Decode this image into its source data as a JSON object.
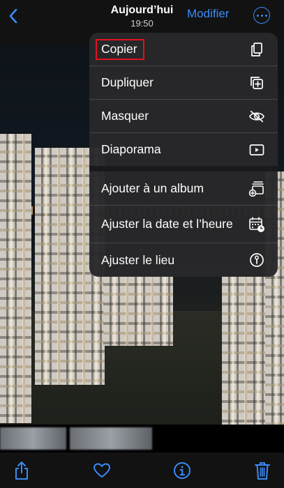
{
  "header": {
    "back_icon": "chevron-left-icon",
    "title": "Aujourd’hui",
    "subtitle": "19:50",
    "edit_label": "Modifier",
    "more_icon": "ellipsis-circle-icon",
    "accent_color": "#3b8bf6"
  },
  "menu": {
    "items": [
      {
        "label": "Copier",
        "icon": "copy-icon",
        "highlighted": true
      },
      {
        "label": "Dupliquer",
        "icon": "duplicate-icon"
      },
      {
        "label": "Masquer",
        "icon": "eye-slash-icon"
      },
      {
        "label": "Diaporama",
        "icon": "play-rectangle-icon"
      },
      {
        "label": "Ajouter à un album",
        "icon": "add-to-album-icon"
      },
      {
        "label": "Ajuster la date et l’heure",
        "icon": "calendar-adjust-icon"
      },
      {
        "label": "Ajuster le lieu",
        "icon": "location-info-icon"
      }
    ],
    "highlight_color": "#e0141e"
  },
  "toolbar": {
    "share_icon": "share-icon",
    "favorite_icon": "heart-icon",
    "info_icon": "info-icon",
    "delete_icon": "trash-icon"
  }
}
